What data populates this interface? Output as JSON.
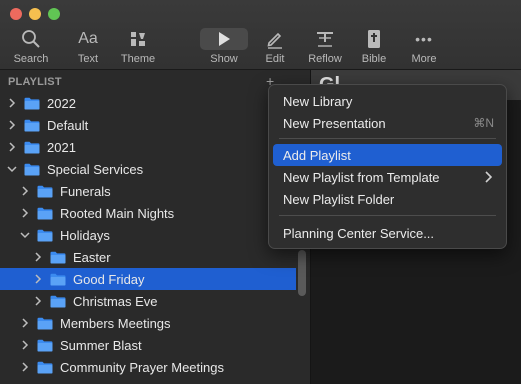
{
  "toolbar": {
    "items": [
      {
        "label": "Search",
        "icon": "magnifier"
      },
      {
        "label": "Text",
        "icon": "Aa"
      },
      {
        "label": "Theme",
        "icon": "theme"
      },
      {
        "label": "Show",
        "icon": "play"
      },
      {
        "label": "Edit",
        "icon": "pencil"
      },
      {
        "label": "Reflow",
        "icon": "reflow"
      },
      {
        "label": "Bible",
        "icon": "book"
      },
      {
        "label": "More",
        "icon": "ellipsis"
      }
    ],
    "text_glyph": "Aa",
    "more_glyph": "•••"
  },
  "sidebar": {
    "header": "PLAYLIST",
    "add_glyph": "+",
    "rows": [
      {
        "label": "2022",
        "level": 0,
        "expanded": false
      },
      {
        "label": "Default",
        "level": 0,
        "expanded": false
      },
      {
        "label": "2021",
        "level": 0,
        "expanded": false
      },
      {
        "label": "Special Services",
        "level": 0,
        "expanded": true
      },
      {
        "label": "Funerals",
        "level": 1,
        "expanded": false
      },
      {
        "label": "Rooted Main Nights",
        "level": 1,
        "expanded": false
      },
      {
        "label": "Holidays",
        "level": 1,
        "expanded": true
      },
      {
        "label": "Easter",
        "level": 2,
        "expanded": false
      },
      {
        "label": "Good Friday",
        "level": 2,
        "expanded": false,
        "selected": true
      },
      {
        "label": "Christmas Eve",
        "level": 2,
        "expanded": false
      },
      {
        "label": "Members Meetings",
        "level": 1,
        "expanded": false
      },
      {
        "label": "Summer Blast",
        "level": 1,
        "expanded": false
      },
      {
        "label": "Community Prayer Meetings",
        "level": 1,
        "expanded": false
      }
    ]
  },
  "pane": {
    "title": "Gl"
  },
  "context_menu": {
    "items": [
      {
        "label": "New Library"
      },
      {
        "label": "New Presentation",
        "shortcut": "⌘N"
      },
      {
        "label": "Add Playlist",
        "highlighted": true
      },
      {
        "label": "New Playlist from Template",
        "submenu": true
      },
      {
        "label": "New Playlist Folder"
      },
      {
        "label": "Planning Center Service..."
      }
    ]
  },
  "colors": {
    "selection": "#1f5fd1",
    "folder": "#3b8bf0"
  }
}
